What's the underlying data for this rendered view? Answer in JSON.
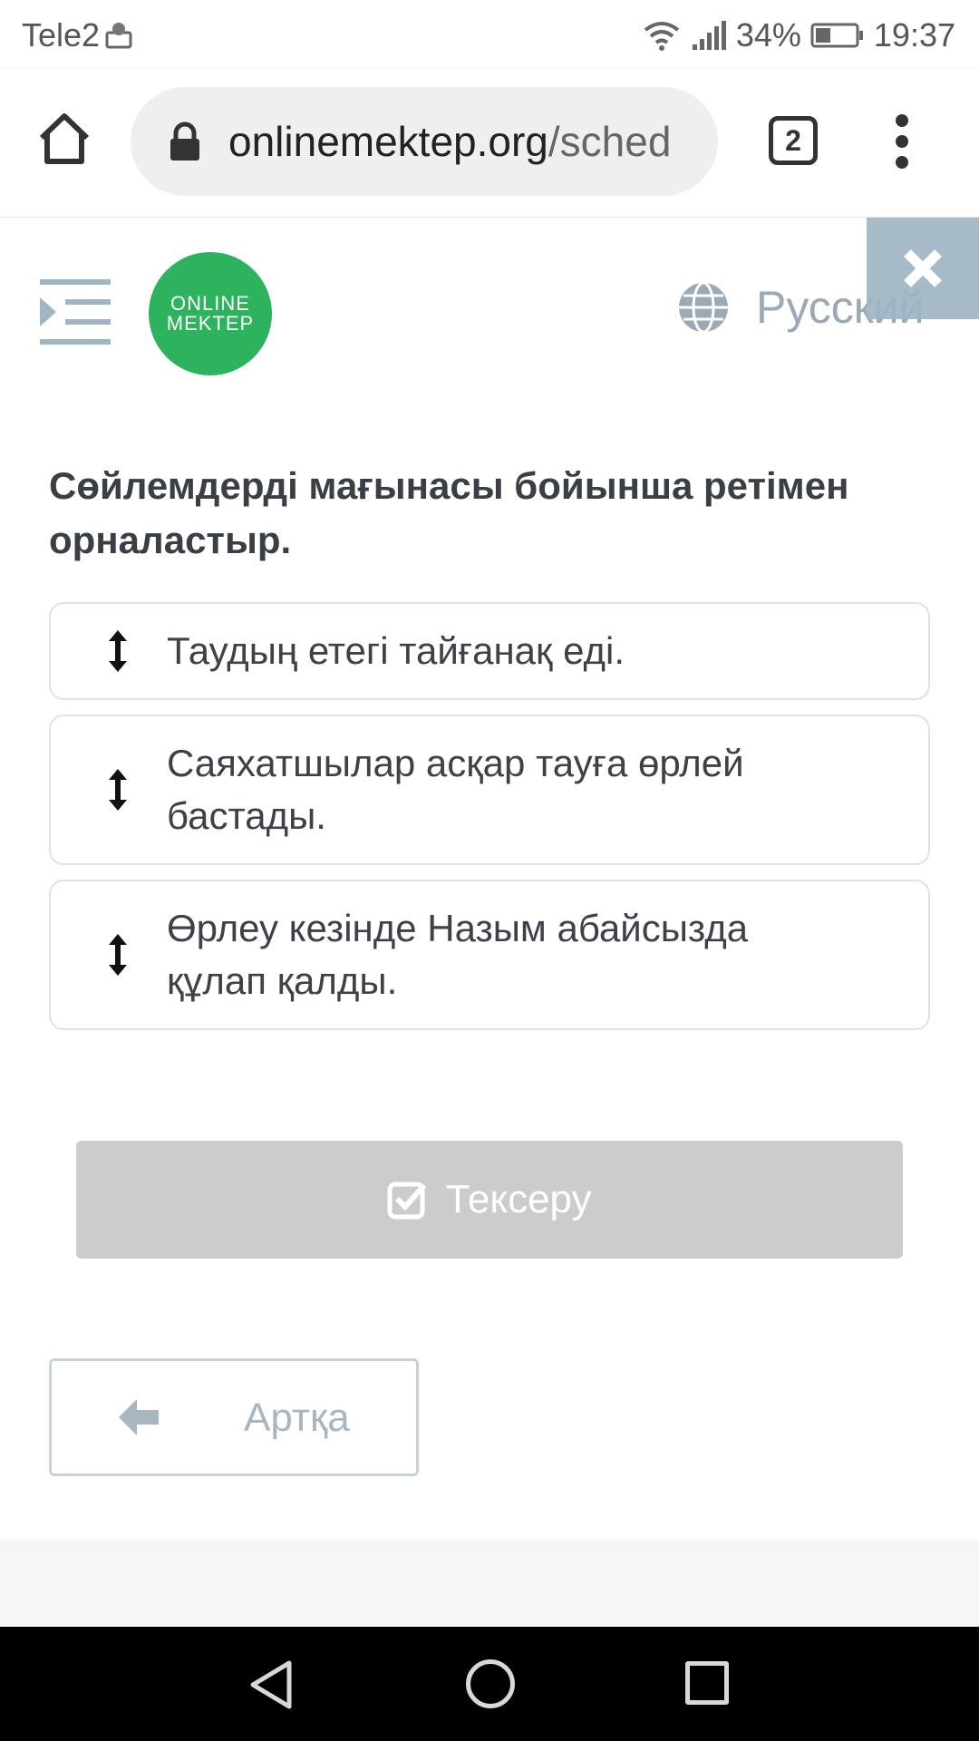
{
  "status_bar": {
    "carrier": "Tele2",
    "battery": "34%",
    "time": "19:37"
  },
  "browser": {
    "url_domain": "onlinemektep.org",
    "url_path": "/sched",
    "tab_count": "2"
  },
  "header": {
    "logo_line1": "ONLINE",
    "logo_line2": "MEKTEP",
    "language": "Русский"
  },
  "exercise": {
    "title": "Сөйлемдерді мағынасы бойынша ретімен орналастыр.",
    "items": [
      {
        "text": "Таудың етегі тайғанақ еді."
      },
      {
        "text": "Саяхатшылар асқар тауға өрлей бастады."
      },
      {
        "text": "Өрлеу кезінде Назым абайсызда құлап қалды."
      }
    ],
    "check_label": "Тексеру",
    "back_label": "Артқа"
  },
  "colors": {
    "logo_green": "#2db35d",
    "close_bg": "#9fb5c4",
    "check_bg": "#cccccc",
    "muted_text": "#a8b6c0"
  }
}
